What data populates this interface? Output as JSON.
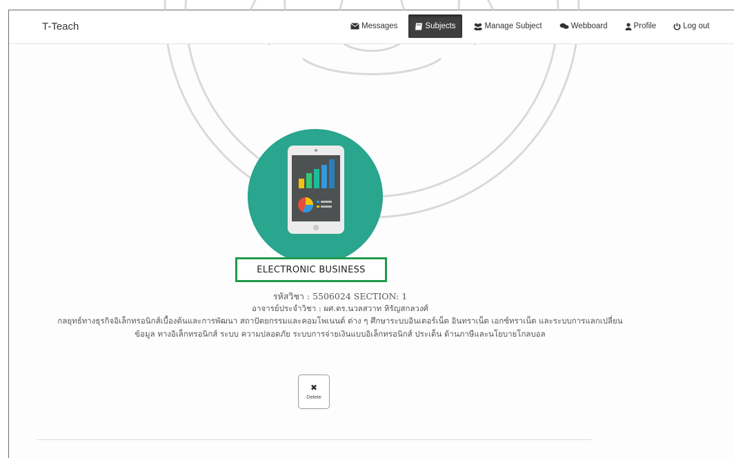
{
  "app": {
    "brand": "T-Teach"
  },
  "nav": {
    "items": [
      {
        "label": "Messages",
        "icon": "envelope-icon",
        "active": false
      },
      {
        "label": "Subjects",
        "icon": "book-icon",
        "active": true
      },
      {
        "label": "Manage Subject",
        "icon": "users-icon",
        "active": false
      },
      {
        "label": "Webboard",
        "icon": "comments-icon",
        "active": false
      },
      {
        "label": "Profile",
        "icon": "user-icon",
        "active": false
      },
      {
        "label": "Log out",
        "icon": "power-icon",
        "active": false
      }
    ]
  },
  "subject": {
    "title": "ELECTRONIC BUSINESS",
    "code_line": "รหัสวิชา : 5506024 SECTION: 1",
    "teacher_line": "อาจารย์ประจำวิชา : ผศ.ดร.นวลสวาท หิรัญสกลวงศ์",
    "description": "กลยุทธ์ทางธุรกิจอิเล็กทรอนิกส์เบื้องต้นและการพัฒนา สถาปัตยกรรมและคอมโพเนนต์ ต่าง ๆ ศึกษาระบบอินเตอร์เน็ต อินทราเน็ต เอกซ์ทราเน็ต และระบบการแลกเปลี่ยนข้อมูล ทางอิเล็กทรอนิกส์ ระบบ ความปลอดภัย ระบบการจ่ายเงินแบบอิเล็กทรอนิกส์ ประเด็น ด้านภาษีและนโยบายโกลบอล",
    "image_icon": "tablet-chart-icon"
  },
  "actions": {
    "delete_label": "Delete",
    "delete_icon": "✖"
  },
  "colors": {
    "logo_bg": "#2aa58e",
    "highlight_border": "#1f9a4b",
    "active_nav_bg": "#3f3f3f"
  }
}
